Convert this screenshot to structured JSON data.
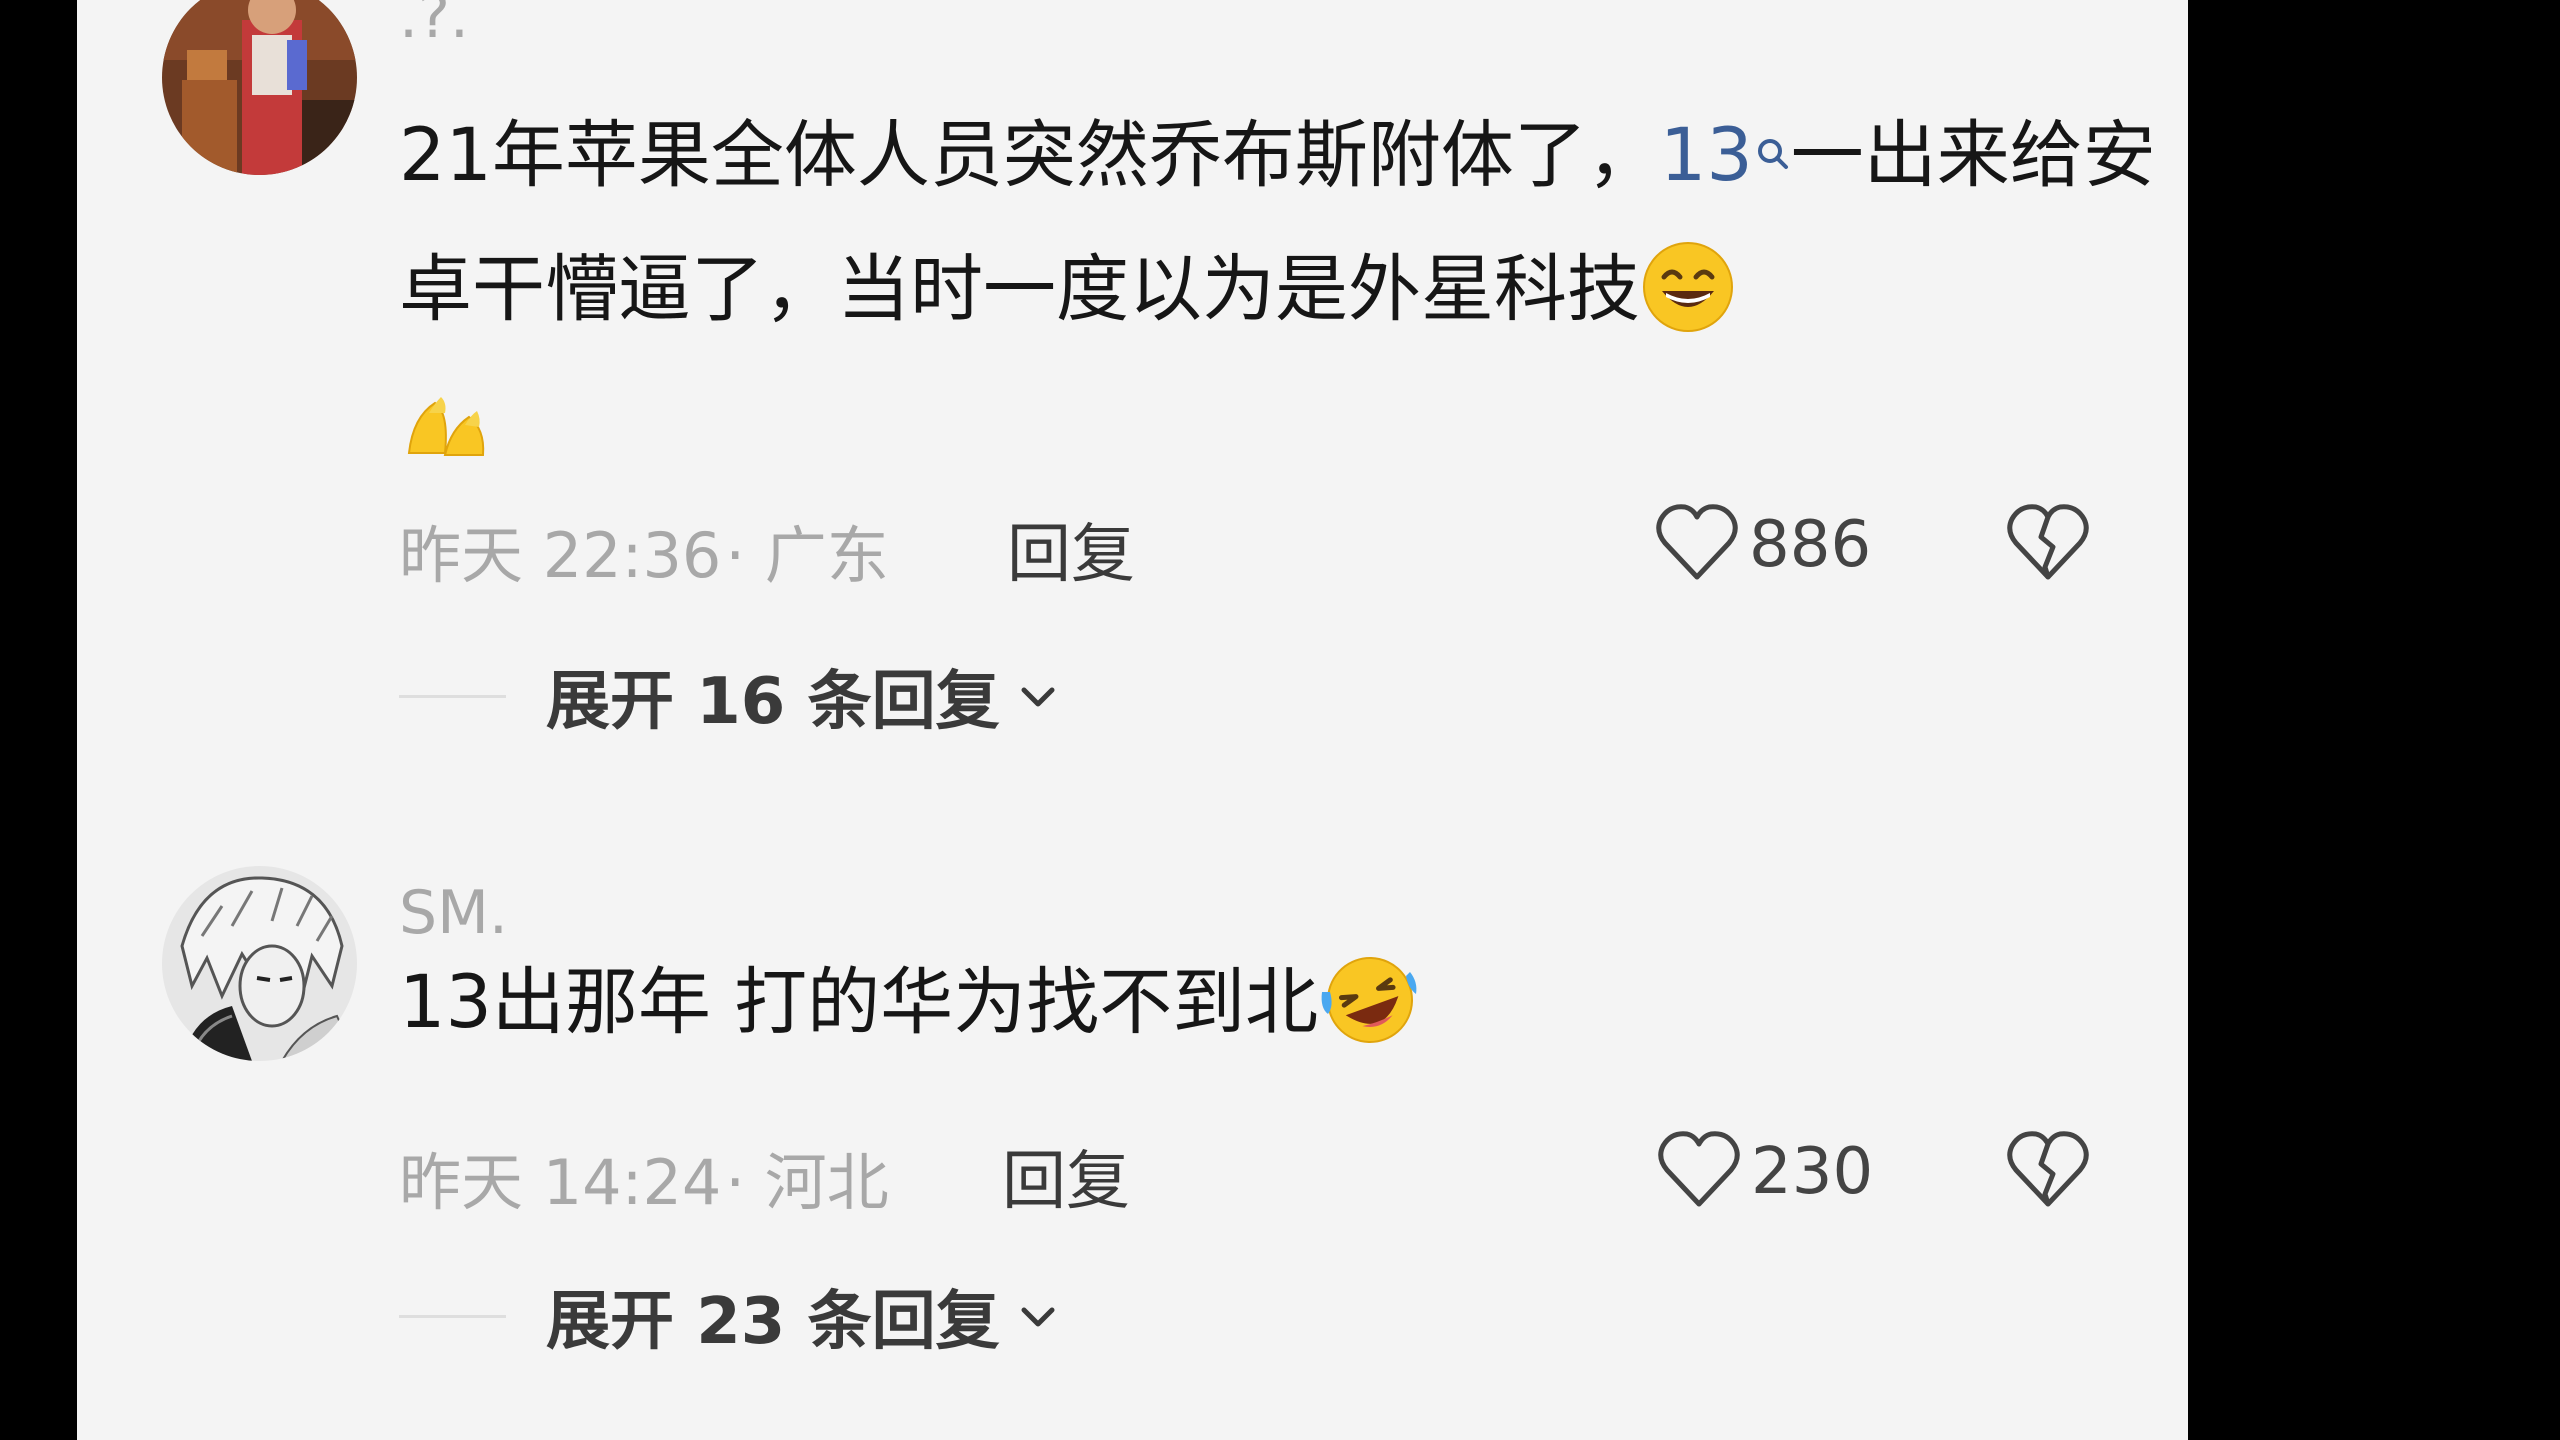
{
  "comments": [
    {
      "username": ".?.",
      "text_before_link": "21年苹果全体人员突然乔布斯附体了，",
      "link_term": "13",
      "text_after_link": "一出来给安卓干懵逼了，当时一度以为是外星科技",
      "emojis": [
        "grin-emoji",
        "tapping-fingers-emoji"
      ],
      "time": "昨天 22:36",
      "region": "· 广东",
      "reply_label": "回复",
      "likes": "886",
      "expand_label": "展开 16 条回复",
      "avatar": "avatar-illustrated-figure"
    },
    {
      "username": "SM.",
      "text_before_link": "13出那年 打的华为找不到北",
      "emojis": [
        "rolling-laughing-emoji"
      ],
      "time": "昨天 14:24",
      "region": "· 河北",
      "reply_label": "回复",
      "likes": "230",
      "expand_label": "展开 23 条回复",
      "avatar": "avatar-manga-sketch"
    }
  ],
  "colors": {
    "panel_bg": "#f4f4f4",
    "outer_bg": "#000000",
    "text_primary": "#161616",
    "text_secondary": "#a8a8a8",
    "link": "#3b5e96"
  }
}
